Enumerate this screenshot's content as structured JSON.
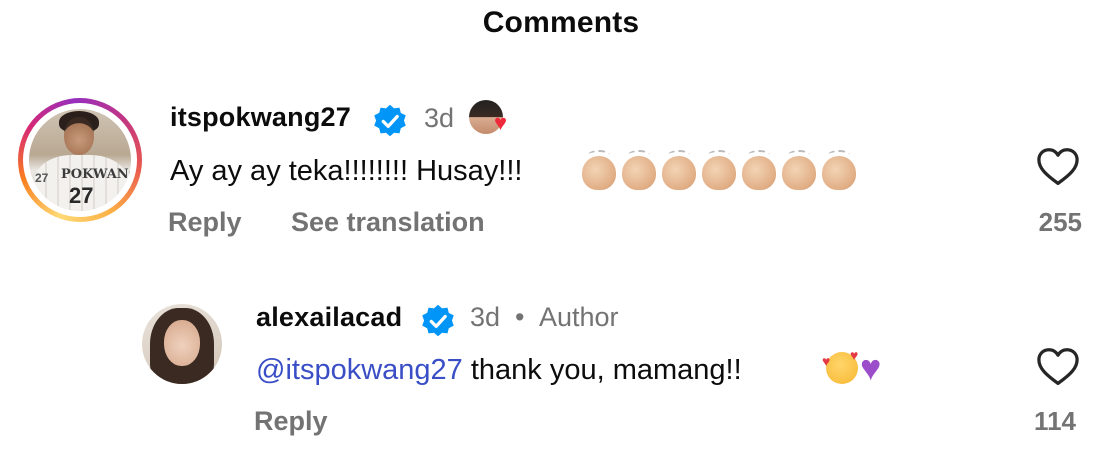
{
  "header": {
    "title": "Comments"
  },
  "comments": [
    {
      "username": "itspokwang27",
      "time": "3d",
      "text": "Ay ay ay teka!!!!!!!! Husay!!!",
      "emoji_count": 7,
      "reply_label": "Reply",
      "translate_label": "See translation",
      "like_count": "255",
      "jersey_text": "POKWANG",
      "jersey_number": "27",
      "side_number": "27"
    },
    {
      "username": "alexailacad",
      "time": "3d",
      "separator": "•",
      "author_label": "Author",
      "mention": "@itspokwang27",
      "text": " thank you, mamang!!",
      "reply_label": "Reply",
      "like_count": "114"
    }
  ],
  "icons": {
    "verified": "verified-badge-icon",
    "heart": "heart-outline-icon",
    "clap": "clapping-hands-icon"
  },
  "colors": {
    "verified_blue": "#0095f6",
    "mention_blue": "#3a4ec6",
    "secondary_text": "#737373"
  }
}
